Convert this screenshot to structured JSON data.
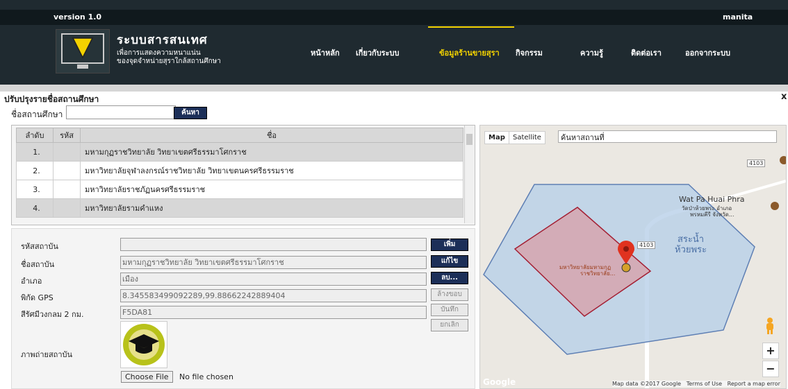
{
  "header": {
    "version": "version 1.0",
    "user": "manita",
    "app_title": "ระบบสารสนเทศ",
    "app_subtitle1": "เพื่อการแสดงความหนาแน่น",
    "app_subtitle2": "ของจุดจำหน่ายสุราใกล้สถานศึกษา",
    "nav": [
      "หน้าหลัก",
      "เกี่ยวกับระบบ",
      "ข้อมูลร้านขายสุรา",
      "กิจกรรม",
      "ความรู้",
      "ติดต่อเรา",
      "ออกจากระบบ"
    ]
  },
  "panel": {
    "title": "ปรับปรุงรายชื่อสถานศึกษา",
    "close": "x",
    "search_label": "ชื่อสถานศึกษา",
    "search_value": "",
    "search_button": "ค้นหา"
  },
  "table": {
    "headers": [
      "ลำดับ",
      "รหัส",
      "ชื่อ"
    ],
    "rows": [
      {
        "no": "1.",
        "code": "",
        "name": "มหามกุฏราชวิทยาลัย วิทยาเขตศรีธรรมาโศกราช"
      },
      {
        "no": "2.",
        "code": "",
        "name": "มหาวิทยาลัยจุฬาลงกรณ์ราชวิทยาลัย วิทยาเขตนครศรีธรรมราช"
      },
      {
        "no": "3.",
        "code": "",
        "name": "มหาวิทยาลัยราชภัฏนครศรีธรรมราช"
      },
      {
        "no": "4.",
        "code": "",
        "name": "มหาวิทยาลัยรามคำแหง"
      }
    ]
  },
  "form": {
    "labels": {
      "code": "รหัสสถาบัน",
      "name": "ชื่อสถาบัน",
      "district": "อำเภอ",
      "gps": "พิกัด GPS",
      "color": "สีรัศมีวงกลม 2 กม.",
      "photo": "ภาพถ่ายสถาบัน"
    },
    "values": {
      "code": "",
      "name": "มหามกุฏราชวิทยาลัย วิทยาเขตศรีธรรมาโศกราช",
      "district": "เมือง",
      "gps": "8.345583499092289,99.88662242889404",
      "color": "F5DA81"
    },
    "file_button": "Choose File",
    "file_status": "No file chosen"
  },
  "actions": {
    "add": "เพิ่ม",
    "edit": "แก้ไข",
    "delete": "ลบ...",
    "clear": "ล้างขอบ",
    "save": "บันทึก",
    "cancel": "ยกเลิก"
  },
  "map": {
    "map_tab": "Map",
    "satellite_tab": "Satellite",
    "search_value": "ค้นหาสถานที่",
    "road_4103": "4103",
    "place1": "Wat Pa Huai Phra",
    "place1_th": "วัดป่าห้วยพระ อำเภอ",
    "place1_th2": "พรหมคีรี จังหวัด...",
    "pond": "สระน้ำ",
    "pond2": "ห้วยพระ",
    "marker_label": "มหาวิทยาลัยมหามกุฏ",
    "marker_label2": "ราชวิทยาลัย...",
    "google": "Google",
    "attribution": "Map data ©2017 Google   Terms of Use   Report a map error",
    "zoom_in": "+",
    "zoom_out": "−",
    "polygon_outer_color": "#b8cfe8",
    "polygon_inner_color": "#d6a5ae"
  },
  "colors": {
    "header_bg": "#1f2a30",
    "active_nav": "#f3d200",
    "button_dark": "#1c2f58"
  }
}
